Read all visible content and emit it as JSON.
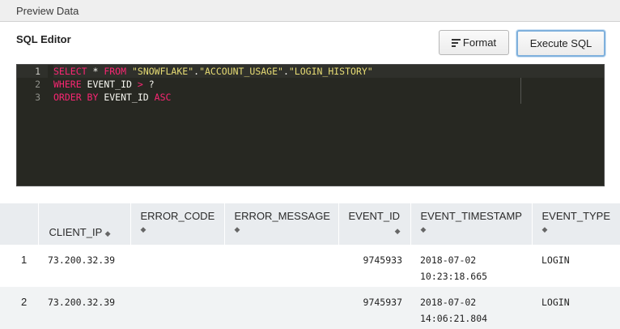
{
  "top_tab": {
    "label": "Preview Data"
  },
  "editor": {
    "title": "SQL Editor",
    "format_label": "Format",
    "execute_label": "Execute SQL",
    "line_numbers": [
      "1",
      "2",
      "3"
    ],
    "tokens": {
      "l1_select": "SELECT",
      "l1_star": " * ",
      "l1_from": "FROM",
      "l1_space": " ",
      "l1_db": "\"SNOWFLAKE\"",
      "l1_dot1": ".",
      "l1_schema": "\"ACCOUNT_USAGE\"",
      "l1_dot2": ".",
      "l1_table": "\"LOGIN_HISTORY\"",
      "l2_where": "WHERE",
      "l2_col": " EVENT_ID ",
      "l2_gt": ">",
      "l2_param": " ?",
      "l3_order": "ORDER BY",
      "l3_col": " EVENT_ID ",
      "l3_asc": "ASC"
    }
  },
  "table": {
    "headers": {
      "client_ip": "CLIENT_IP",
      "error_code": "ERROR_CODE",
      "error_message": "ERROR_MESSAGE",
      "event_id": "EVENT_ID",
      "event_timestamp": "EVENT_TIMESTAMP",
      "event_type": "EVENT_TYPE",
      "sort_glyph_both": "▲▼",
      "sort_glyph": "◆"
    },
    "rows": [
      {
        "num": "1",
        "client_ip": "73.200.32.39",
        "error_code": "",
        "error_message": "",
        "event_id": "9745933",
        "ts_date": "2018-07-02",
        "ts_time": "10:23:18.665",
        "event_type": "LOGIN"
      },
      {
        "num": "2",
        "client_ip": "73.200.32.39",
        "error_code": "",
        "error_message": "",
        "event_id": "9745937",
        "ts_date": "2018-07-02",
        "ts_time": "14:06:21.804",
        "event_type": "LOGIN"
      }
    ]
  },
  "icons": {
    "format": "align-left-icon",
    "sort": "sort-icon"
  }
}
